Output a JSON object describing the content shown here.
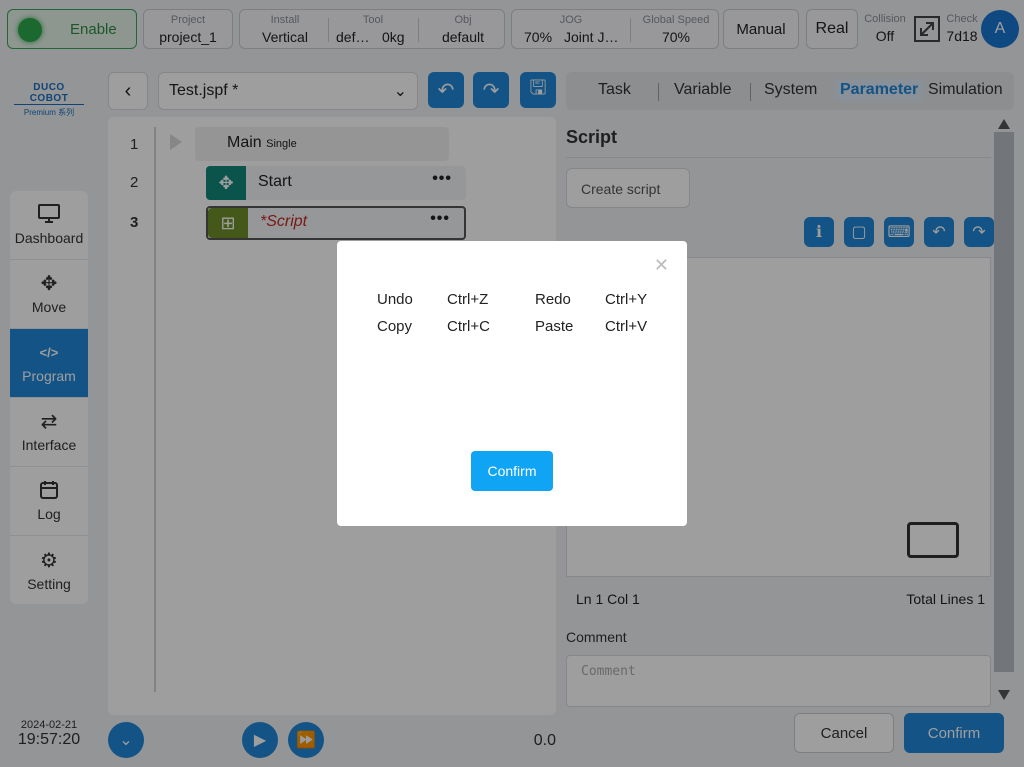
{
  "topbar": {
    "enable_label": "Enable",
    "project": {
      "label": "Project",
      "value": "project_1"
    },
    "install": {
      "label": "Install",
      "value": "Vertical"
    },
    "tool": {
      "label": "Tool",
      "value": "def…",
      "weight": "0kg"
    },
    "obj": {
      "label": "Obj",
      "value": "default"
    },
    "jog": {
      "label": "JOG",
      "percent": "70%",
      "mode": "Joint J…"
    },
    "global_speed": {
      "label": "Global Speed",
      "value": "70%"
    },
    "manual_label": "Manual",
    "real_label": "Real",
    "collision": {
      "label": "Collision",
      "value": "Off"
    },
    "check": {
      "label": "Check",
      "value": "7d18"
    },
    "avatar_letter": "A"
  },
  "logo": {
    "line1": "DUCO COBOT",
    "line2": "Premium 系列"
  },
  "nav": {
    "items": [
      {
        "label": "Dashboard",
        "icon": "monitor-icon"
      },
      {
        "label": "Move",
        "icon": "move-icon"
      },
      {
        "label": "Program",
        "icon": "code-icon"
      },
      {
        "label": "Interface",
        "icon": "interface-icon"
      },
      {
        "label": "Log",
        "icon": "calendar-icon"
      },
      {
        "label": "Setting",
        "icon": "gear-icon"
      }
    ],
    "active": "Program"
  },
  "datetime": {
    "date": "2024-02-21",
    "time": "19:57:20"
  },
  "editor": {
    "file_name": "Test.jspf *",
    "lines": [
      "1",
      "2",
      "3"
    ],
    "main_label": "Main",
    "main_mode": "Single",
    "node_start": "Start",
    "node_script": "*Script",
    "speed_value": "0.0"
  },
  "tabs": [
    "Task",
    "Variable",
    "System",
    "Parameter",
    "Simulation"
  ],
  "active_tab": "Parameter",
  "panel": {
    "title": "Script",
    "create_placeholder": "Create script",
    "status_ln": "Ln 1 Col 1",
    "status_total": "Total Lines 1",
    "comment_label": "Comment",
    "comment_placeholder": "Comment",
    "cancel_label": "Cancel",
    "confirm_label": "Confirm"
  },
  "modal": {
    "shortcuts": [
      {
        "action": "Undo",
        "keys": "Ctrl+Z"
      },
      {
        "action": "Redo",
        "keys": "Ctrl+Y"
      },
      {
        "action": "Copy",
        "keys": "Ctrl+C"
      },
      {
        "action": "Paste",
        "keys": "Ctrl+V"
      }
    ],
    "confirm_label": "Confirm"
  },
  "colors": {
    "accent": "#1f86d8",
    "enable_green": "#2eaa4e",
    "script_node": "#6e8f2a",
    "move_node": "#11887a",
    "modal_confirm": "#10a4f4"
  }
}
